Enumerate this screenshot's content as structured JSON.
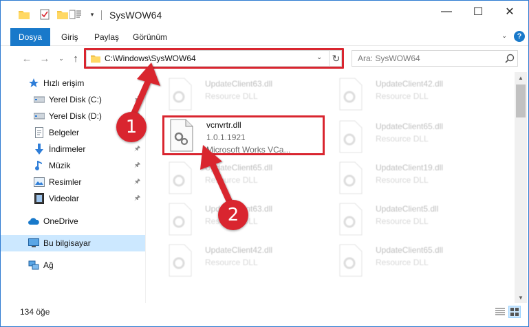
{
  "window": {
    "title": "SysWOW64",
    "minimize_glyph": "—",
    "maximize_glyph": "☐",
    "close_glyph": "✕"
  },
  "quick_access_toolbar": {
    "icons": [
      "folder-icon",
      "properties-check-icon",
      "new-folder-icon",
      "properties-icon"
    ],
    "dropdown_glyph": "▾"
  },
  "ribbon": {
    "tabs": [
      "Dosya",
      "Giriş",
      "Paylaş",
      "Görünüm"
    ],
    "expand_glyph": "⌄",
    "help_glyph": "?"
  },
  "address_bar": {
    "back_glyph": "←",
    "forward_glyph": "→",
    "recent_glyph": "⌄",
    "up_glyph": "↑",
    "path": "C:\\Windows\\SysWOW64",
    "dropdown_glyph": "⌄",
    "refresh_glyph": "↻"
  },
  "search": {
    "placeholder": "Ara: SysWOW64"
  },
  "nav_pane": {
    "items": [
      {
        "label": "Hızlı erişim",
        "icon": "star-icon"
      },
      {
        "label": "Yerel Disk (C:)",
        "icon": "drive-icon",
        "pinned": true
      },
      {
        "label": "Yerel Disk (D:)",
        "icon": "drive-icon",
        "pinned": true
      },
      {
        "label": "Belgeler",
        "icon": "documents-icon",
        "pinned": true
      },
      {
        "label": "İndirmeler",
        "icon": "download-icon",
        "pinned": true
      },
      {
        "label": "Müzik",
        "icon": "music-icon",
        "pinned": true
      },
      {
        "label": "Resimler",
        "icon": "pictures-icon",
        "pinned": true
      },
      {
        "label": "Videolar",
        "icon": "videos-icon",
        "pinned": true
      },
      {
        "label": "OneDrive",
        "icon": "cloud-icon"
      },
      {
        "label": "Bu bilgisayar",
        "icon": "computer-icon",
        "selected": true
      },
      {
        "label": "Ağ",
        "icon": "network-icon"
      }
    ],
    "pin_glyph": "📌"
  },
  "files": {
    "highlighted": {
      "name": "vcnvrtr.dll",
      "version": "1.0.1.1921",
      "description": "Microsoft Works VCa..."
    },
    "background_items": [
      {
        "name": "UpdateClient63.dll",
        "type": "Resource DLL"
      },
      {
        "name": "UpdateClient42.dll",
        "type": "Resource DLL"
      },
      {
        "name": "UpdateClient65.dll",
        "type": "Resource DLL"
      },
      {
        "name": "UpdateClient65.dll",
        "type": "Resource DLL"
      },
      {
        "name": "UpdateClient19.dll",
        "type": "Resource DLL"
      },
      {
        "name": "UpdateClient63.dll",
        "type": "Resource DLL"
      },
      {
        "name": "UpdateClient5.dll",
        "type": "Resource DLL"
      },
      {
        "name": "UpdateClient42.dll",
        "type": "Resource DLL"
      },
      {
        "name": "UpdateClient65.dll",
        "type": "Resource DLL"
      }
    ]
  },
  "status_bar": {
    "item_count": "134 öğe"
  },
  "annotations": {
    "step1": "1",
    "step2": "2",
    "highlight_color": "#d9252f"
  },
  "colors": {
    "accent": "#1979ca",
    "selection": "#cce8ff",
    "callout": "#d9252f"
  }
}
